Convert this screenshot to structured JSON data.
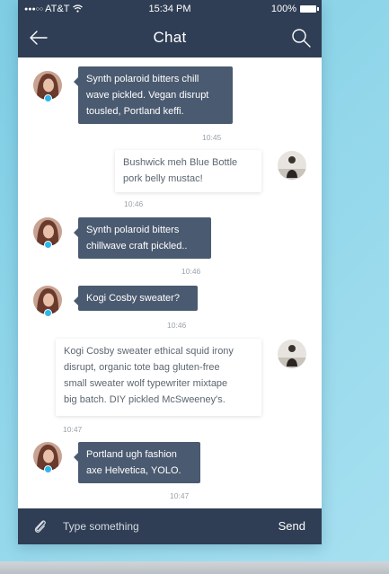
{
  "status_bar": {
    "signal_dots": "●●●○○",
    "carrier": "AT&T",
    "time": "15:34 PM",
    "battery": "100%"
  },
  "header": {
    "title": "Chat"
  },
  "messages": [
    {
      "direction": "in",
      "lines": [
        "Synth polaroid bitters chill",
        "wave pickled. Vegan disrupt",
        "tousled, Portland keffi."
      ],
      "time": "10:45",
      "online": true
    },
    {
      "direction": "out",
      "lines": [
        "Bushwick meh Blue Bottle",
        "pork belly mustac!"
      ],
      "time": "10:46"
    },
    {
      "direction": "in",
      "lines": [
        "Synth polaroid bitters",
        "chillwave craft pickled.."
      ],
      "time": "10:46",
      "online": true
    },
    {
      "direction": "in",
      "lines": [
        "Kogi Cosby sweater?"
      ],
      "time": "10:46",
      "online": true
    },
    {
      "direction": "out",
      "lines": [
        "Kogi Cosby sweater ethical squid irony",
        "disrupt, organic tote bag gluten-free",
        "small sweater wolf typewriter mixtape",
        "big batch. DIY pickled McSweeney's."
      ],
      "time": "10:47"
    },
    {
      "direction": "in",
      "lines": [
        "Portland ugh fashion",
        "axe Helvetica, YOLO."
      ],
      "time": "10:47",
      "online": true
    }
  ],
  "composer": {
    "placeholder": "Type something",
    "send_label": "Send"
  },
  "colors": {
    "bar": "#2f3e54",
    "incoming_bubble": "#4a5a70",
    "online_dot": "#2fb6ea",
    "background": "#8fd5e9"
  },
  "icons": {
    "back": "arrow-left-icon",
    "search": "search-icon",
    "attach": "paperclip-icon"
  }
}
